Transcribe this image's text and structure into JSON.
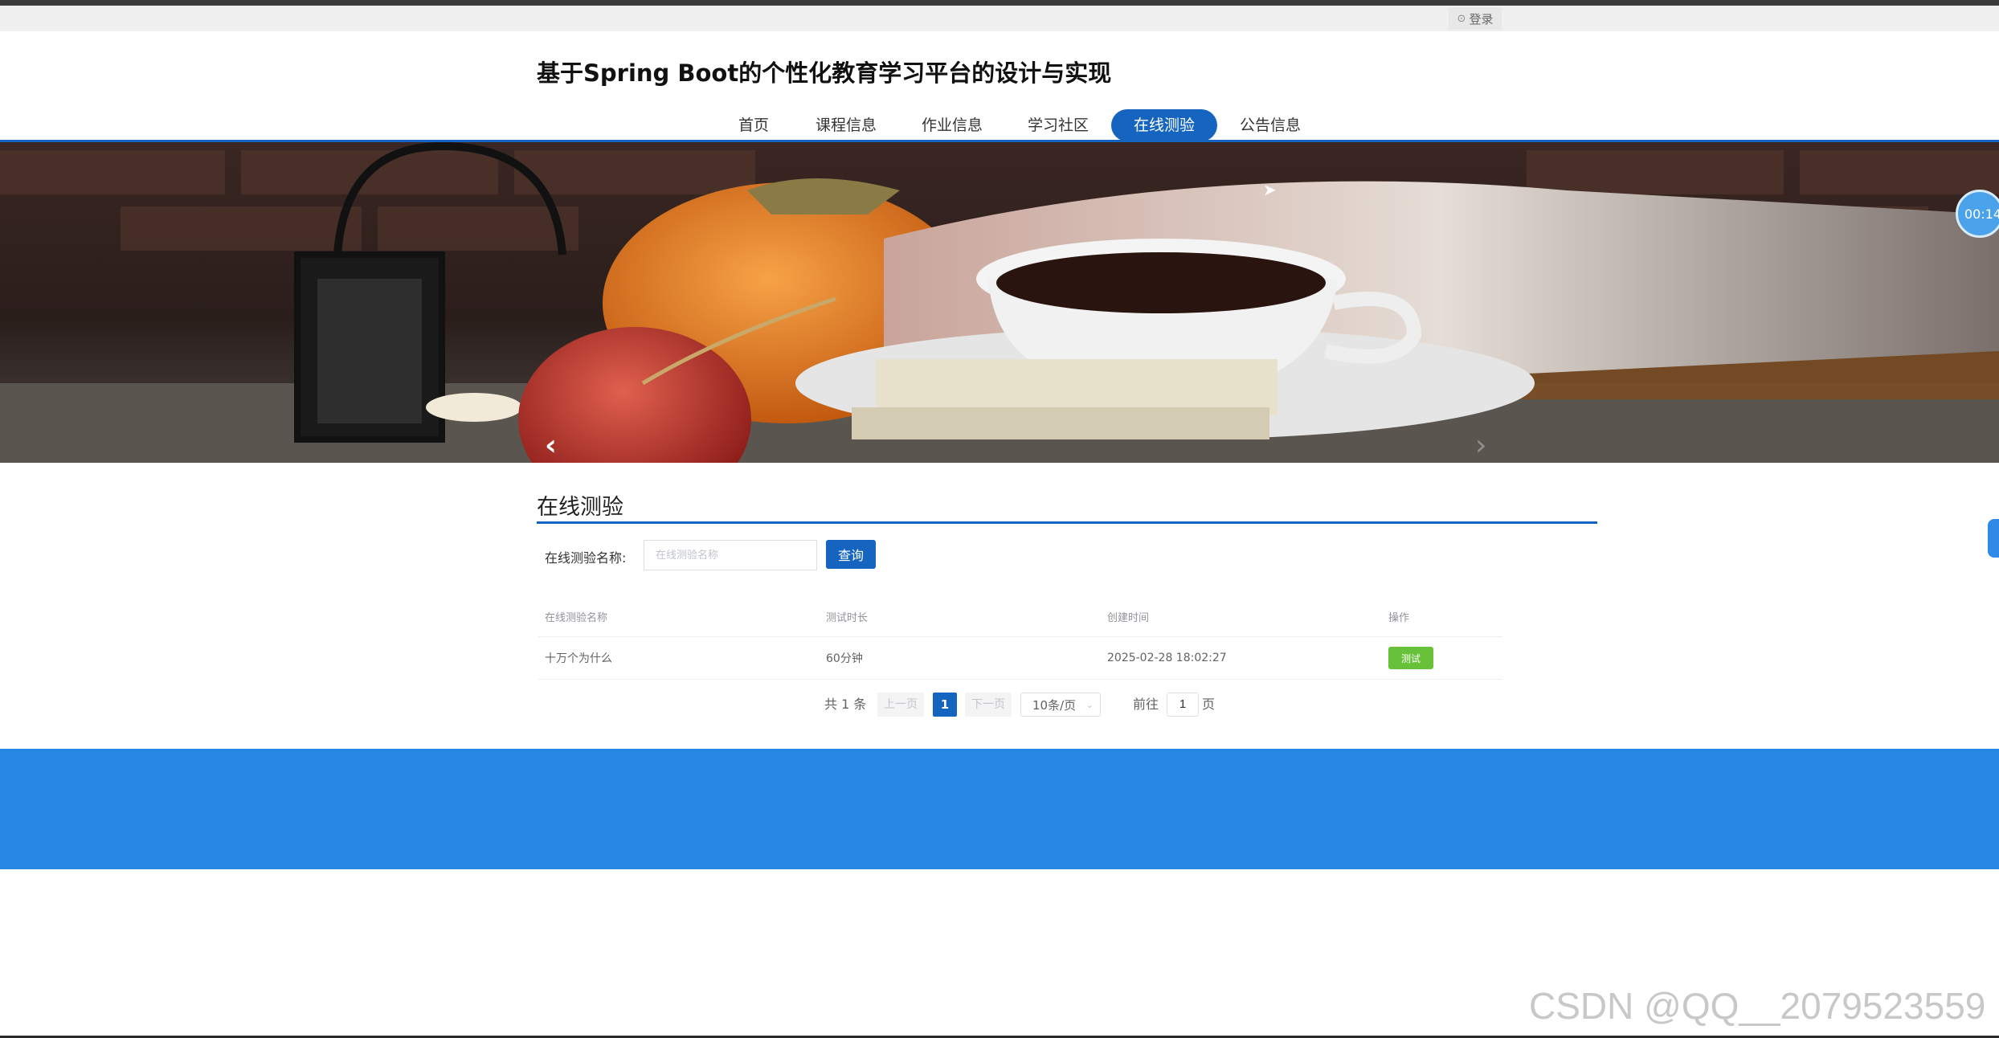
{
  "header": {
    "login_label": "登录",
    "login_icon": "user-circle-icon"
  },
  "site_title": "基于Spring Boot的个性化教育学习平台的设计与实现",
  "nav": {
    "items": [
      {
        "label": "首页"
      },
      {
        "label": "课程信息"
      },
      {
        "label": "作业信息"
      },
      {
        "label": "学习社区"
      },
      {
        "label": "在线测验",
        "active": true
      },
      {
        "label": "公告信息"
      }
    ]
  },
  "carousel": {
    "prev_icon": "chevron-left-icon",
    "next_icon": "chevron-right-icon",
    "slide_count": 3,
    "active_slide": 3
  },
  "timer": {
    "text": "00:14"
  },
  "section": {
    "title": "在线测验"
  },
  "search": {
    "label": "在线测验名称:",
    "placeholder": "在线测验名称",
    "value": "",
    "button_label": "查询"
  },
  "table": {
    "headers": [
      "在线测验名称",
      "测试时长",
      "创建时间",
      "操作"
    ],
    "rows": [
      {
        "name": "十万个为什么",
        "duration": "60分钟",
        "created": "2025-02-28 18:02:27",
        "action": "测试"
      }
    ]
  },
  "pagination": {
    "total_text": "共 1 条",
    "prev_label": "上一页",
    "current_page": "1",
    "next_label": "下一页",
    "page_size": "10条/页",
    "goto_label": "前往",
    "goto_value": "1",
    "page_suffix": "页"
  },
  "watermark": "CSDN @QQ__2079523559",
  "colors": {
    "primary": "#1565c0",
    "footer": "#2787e4",
    "success": "#67c23a"
  }
}
